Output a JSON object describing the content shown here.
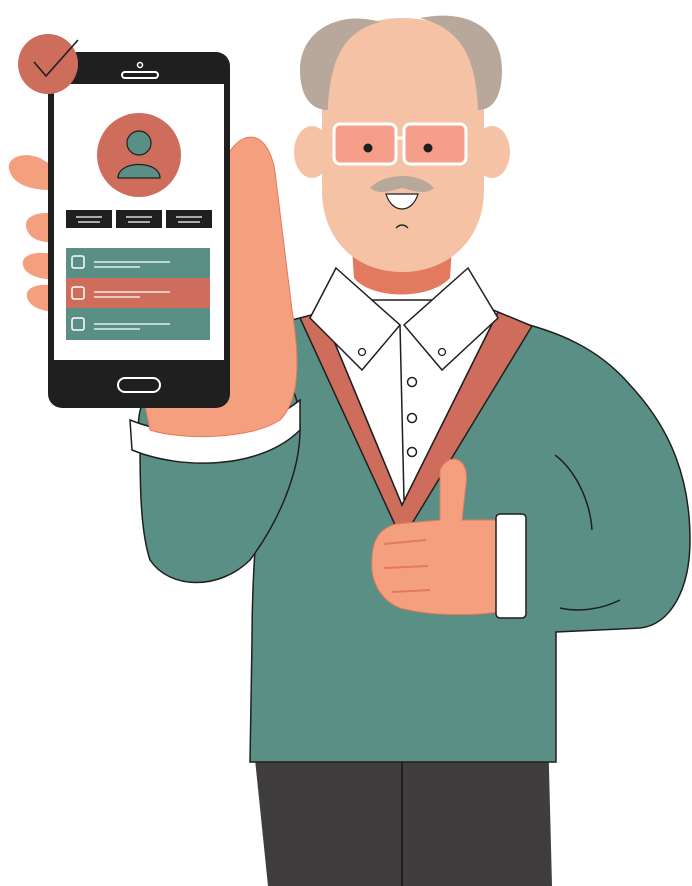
{
  "illustration": {
    "subject": "",
    "phone_ui": {
      "profile_icon": "user-icon",
      "checkmark_badge_icon": "checkmark-icon",
      "tabs": [
        {
          "icon": "menu-lines-icon"
        },
        {
          "icon": "menu-lines-icon"
        },
        {
          "icon": "menu-lines-icon"
        }
      ],
      "list_items": [
        {
          "color": "#5a8f86",
          "checked": false
        },
        {
          "color": "#cf6d5c",
          "checked": false
        },
        {
          "color": "#5a8f86",
          "checked": false
        }
      ]
    },
    "colors": {
      "teal": "#5a8f86",
      "coral": "#cf6d5c",
      "skin": "#f4a07f",
      "skin_light": "#f6c2a6",
      "hair": "#b8a89b",
      "phone_body": "#1f1f1f",
      "trousers": "#3f3d3d",
      "shirt": "#ffffff"
    }
  }
}
